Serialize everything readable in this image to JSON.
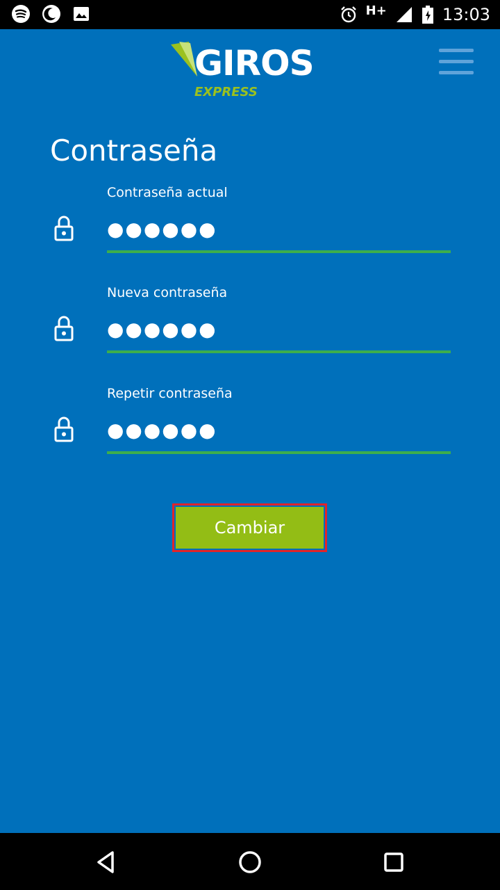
{
  "status_bar": {
    "time": "13:03",
    "network": "H+",
    "icons": [
      "spotify-icon",
      "moon-icon",
      "image-icon",
      "alarm-icon",
      "signal-icon",
      "battery-icon"
    ]
  },
  "header": {
    "logo_main": "GIROS",
    "logo_sub": "EXPRESS",
    "menu_icon": "hamburger-menu-icon"
  },
  "page": {
    "title": "Contraseña"
  },
  "fields": [
    {
      "label": "Contraseña actual",
      "value": "●●●●●●",
      "icon": "lock-icon"
    },
    {
      "label": "Nueva contraseña",
      "value": "●●●●●●",
      "icon": "lock-icon"
    },
    {
      "label": "Repetir contraseña",
      "value": "●●●●●●",
      "icon": "lock-icon"
    }
  ],
  "actions": {
    "submit_label": "Cambiar"
  },
  "nav_bar": {
    "icons": [
      "back-icon",
      "home-icon",
      "recents-icon"
    ]
  },
  "colors": {
    "background": "#0070BB",
    "accent_green": "#93BD15",
    "underline_green": "#3DAE4C",
    "highlight_red": "#E1242A"
  }
}
